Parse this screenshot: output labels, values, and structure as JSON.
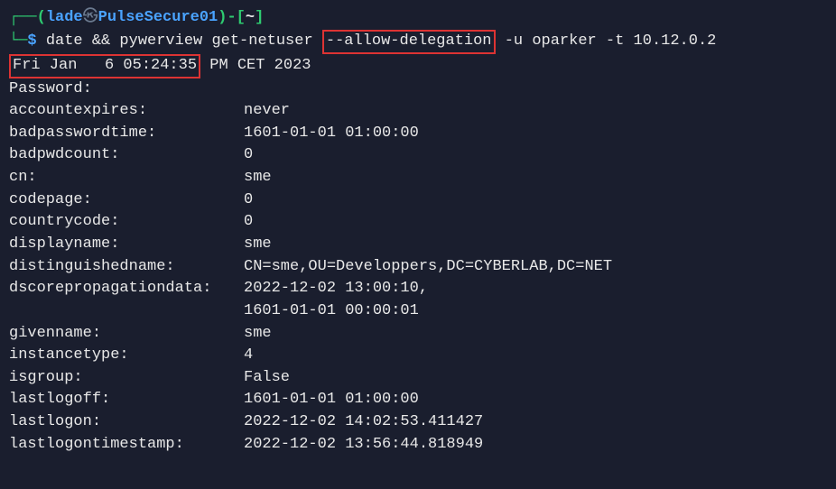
{
  "prompt": {
    "open_paren": "┌──(",
    "user": "lade",
    "at": "㉿",
    "host": "PulseSecure01",
    "close_paren": ")",
    "path_open": "-[",
    "path": "~",
    "path_close": "]"
  },
  "prompt2": {
    "branch": "└─",
    "dollar": "$"
  },
  "command": {
    "before_box": "date && pywerview get-netuser ",
    "boxed_flag": "--allow-delegation",
    "after_box": " -u oparker -t 10.12.0.2"
  },
  "dateline": {
    "boxed": "Fri Jan   6 05:24:35",
    "rest": " PM CET 2023"
  },
  "rows": [
    {
      "k": "Password:",
      "v": ""
    },
    {
      "k": "accountexpires:",
      "v": "never"
    },
    {
      "k": "badpasswordtime:",
      "v": "1601-01-01 01:00:00"
    },
    {
      "k": "badpwdcount:",
      "v": "0"
    },
    {
      "k": "cn:",
      "v": "sme"
    },
    {
      "k": "codepage:",
      "v": "0"
    },
    {
      "k": "countrycode:",
      "v": "0"
    },
    {
      "k": "displayname:",
      "v": "sme"
    },
    {
      "k": "distinguishedname:",
      "v": "CN=sme,OU=Developpers,DC=CYBERLAB,DC=NET"
    },
    {
      "k": "dscorepropagationdata:",
      "v": "2022-12-02 13:00:10,"
    },
    {
      "k": "",
      "v": "1601-01-01 00:00:01"
    },
    {
      "k": "givenname:",
      "v": "sme"
    },
    {
      "k": "instancetype:",
      "v": "4"
    },
    {
      "k": "isgroup:",
      "v": "False"
    },
    {
      "k": "lastlogoff:",
      "v": "1601-01-01 01:00:00"
    },
    {
      "k": "lastlogon:",
      "v": "2022-12-02 14:02:53.411427"
    },
    {
      "k": "lastlogontimestamp:",
      "v": "2022-12-02 13:56:44.818949"
    }
  ]
}
